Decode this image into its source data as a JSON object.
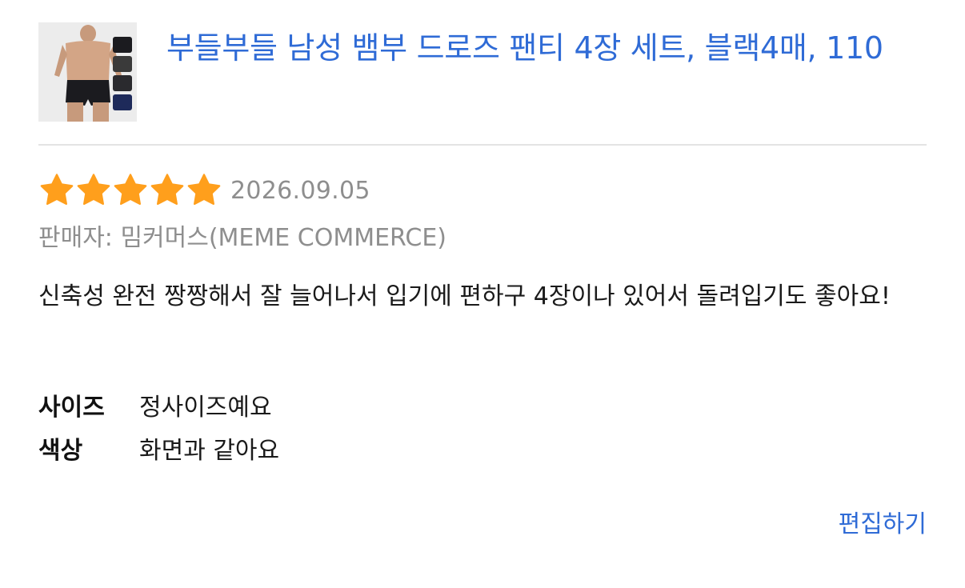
{
  "product": {
    "title": "부들부들 남성 뱀부 드로즈 팬티 4장 세트, 블랙4매, 110",
    "image_alt": "product-thumbnail"
  },
  "review": {
    "rating": 5,
    "max_rating": 5,
    "date": "2026.09.05",
    "seller": "판매자: 밈커머스(MEME COMMERCE)",
    "body": "신축성 완전 짱짱해서 잘 늘어나서 입기에 편하구 4장이나 있어서 돌려입기도 좋아요!",
    "attributes": [
      {
        "label": "사이즈",
        "value": "정사이즈예요"
      },
      {
        "label": "색상",
        "value": "화면과 같아요"
      }
    ],
    "edit_label": "편집하기"
  },
  "colors": {
    "link": "#2f6bd6",
    "star": "#ff9f1c",
    "muted": "#8e8e8e"
  }
}
